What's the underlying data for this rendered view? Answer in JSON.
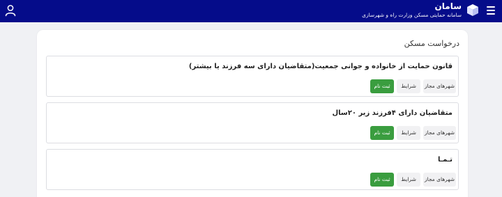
{
  "header": {
    "title": "سامان",
    "subtitle": "سامانه حمایتی مسکن وزارت راه و شهرسازی",
    "menu_icon": "hamburger-menu-icon",
    "logo_icon": "box-logo-icon",
    "user_icon": "user-profile-icon"
  },
  "page": {
    "title": "درخواست مسکن"
  },
  "cards": [
    {
      "title": "قانون حمایت از خانواده و جوانی جمعیت(متقاضیان دارای سه فرزند یا بیشتر)",
      "cities_label": "شهرهای مجاز",
      "terms_label": "شرایط",
      "register_label": "ثبت نام"
    },
    {
      "title": "متقاضیان دارای ۴فرزند زیر ۲۰سال",
      "cities_label": "شهرهای مجاز",
      "terms_label": "شرایط",
      "register_label": "ثبت نام"
    },
    {
      "title": "تـمـا",
      "cities_label": "شهرهای مجاز",
      "terms_label": "شرایط",
      "register_label": "ثبت نام"
    }
  ],
  "colors": {
    "header_bg": "#050c8a",
    "register_bg": "#3a9d3f",
    "page_bg": "#f0f1f4"
  }
}
